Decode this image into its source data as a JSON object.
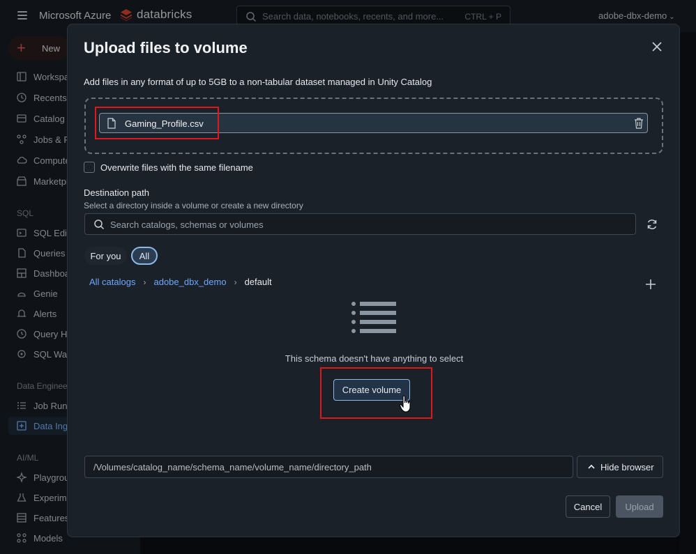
{
  "topbar": {
    "brand_microsoft": "Microsoft Azure",
    "brand_databricks": "databricks",
    "search_placeholder": "Search data, notebooks, recents, and more...",
    "search_shortcut": "CTRL + P",
    "workspace": "adobe-dbx-demo"
  },
  "sidebar": {
    "new_label": "New",
    "items": [
      {
        "label": "Workspace",
        "icon": "folder-icon"
      },
      {
        "label": "Recents",
        "icon": "clock-icon"
      },
      {
        "label": "Catalog",
        "icon": "catalog-icon"
      },
      {
        "label": "Jobs & Pipelines",
        "icon": "jobs-icon"
      },
      {
        "label": "Compute",
        "icon": "cloud-icon"
      },
      {
        "label": "Marketplace",
        "icon": "store-icon"
      }
    ],
    "sql_section": "SQL",
    "sql_items": [
      {
        "label": "SQL Editor",
        "icon": "sql-editor-icon"
      },
      {
        "label": "Queries",
        "icon": "queries-icon"
      },
      {
        "label": "Dashboards",
        "icon": "dashboard-icon"
      },
      {
        "label": "Genie",
        "icon": "genie-icon"
      },
      {
        "label": "Alerts",
        "icon": "bell-icon"
      },
      {
        "label": "Query History",
        "icon": "history-icon"
      },
      {
        "label": "SQL Warehouses",
        "icon": "warehouse-icon"
      }
    ],
    "de_section": "Data Engineering",
    "de_items": [
      {
        "label": "Job Runs",
        "icon": "job-runs-icon"
      },
      {
        "label": "Data Ingestion",
        "icon": "ingestion-icon",
        "active": true
      }
    ],
    "ai_section": "AI/ML",
    "ai_items": [
      {
        "label": "Playground",
        "icon": "sparkle-icon"
      },
      {
        "label": "Experiments",
        "icon": "flask-icon"
      },
      {
        "label": "Features",
        "icon": "features-icon"
      },
      {
        "label": "Models",
        "icon": "models-icon"
      }
    ]
  },
  "modal": {
    "title": "Upload files to volume",
    "subtitle": "Add files in any format of up to 5GB to a non-tabular dataset managed in Unity Catalog",
    "file_name": "Gaming_Profile.csv",
    "overwrite_label": "Overwrite files with the same filename",
    "overwrite_checked": false,
    "destination_label": "Destination path",
    "destination_help": "Select a directory inside a volume or create a new directory",
    "search_placeholder": "Search catalogs, schemas or volumes",
    "chips": {
      "for_you": "For you",
      "all": "All",
      "selected": "All"
    },
    "breadcrumb": {
      "all_catalogs": "All catalogs",
      "catalog": "adobe_dbx_demo",
      "schema": "default"
    },
    "empty_text": "This schema doesn't have anything to select",
    "create_volume": "Create volume",
    "path_placeholder": "/Volumes/catalog_name/schema_name/volume_name/directory_path",
    "hide_browser": "Hide browser",
    "cancel": "Cancel",
    "upload": "Upload"
  },
  "colors": {
    "accent_link": "#6ea8ff",
    "highlight_box": "#e0181c",
    "brand_red": "#e05a4f"
  }
}
